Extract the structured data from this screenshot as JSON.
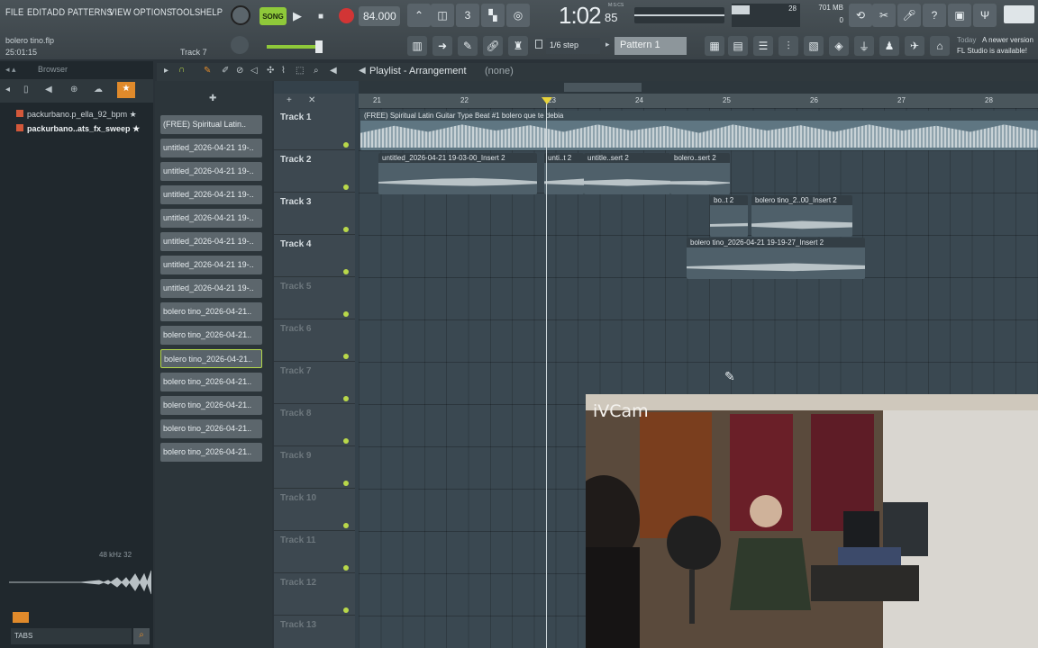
{
  "menu": [
    "FILE",
    "EDIT",
    "ADD",
    "PATTERNS",
    "VIEW",
    "OPTIONS",
    "TOOLS",
    "HELP"
  ],
  "transport": {
    "mode": "SONG",
    "tempo": "84.000",
    "time": "1:02",
    "time_small": "85",
    "time_label": "M:S:CS"
  },
  "monitor": {
    "mem": "701 MB",
    "cpu": "28",
    "poly": "0"
  },
  "project": {
    "file": "bolero tino.flp",
    "position": "25:01:15",
    "target": "Track 7"
  },
  "snap": "1/6 step",
  "pattern_selector": "Pattern 1",
  "news": {
    "label": "Today",
    "line1": "A newer version",
    "line2": "FL Studio is available!"
  },
  "browser": {
    "title": "Browser",
    "items": [
      "packurbano.p_ella_92_bpm",
      "packurbano..ats_fx_sweep"
    ],
    "waveform_info": "48 kHz 32",
    "tabs": "TABS"
  },
  "patterns": [
    "(FREE) Spiritual Latin..",
    "untitled_2026-04-21 19-..",
    "untitled_2026-04-21 19-..",
    "untitled_2026-04-21 19-..",
    "untitled_2026-04-21 19-..",
    "untitled_2026-04-21 19-..",
    "untitled_2026-04-21 19-..",
    "untitled_2026-04-21 19-..",
    "bolero tino_2026-04-21..",
    "bolero tino_2026-04-21..",
    "bolero tino_2026-04-21..",
    "bolero tino_2026-04-21..",
    "bolero tino_2026-04-21..",
    "bolero tino_2026-04-21..",
    "bolero tino_2026-04-21.."
  ],
  "selected_pattern_index": 10,
  "playlist": {
    "title": "Playlist - Arrangement",
    "sub": "(none)"
  },
  "ruler": [
    "21",
    "22",
    "23",
    "24",
    "25",
    "26",
    "27",
    "28"
  ],
  "tracks": [
    "Track 1",
    "Track 2",
    "Track 3",
    "Track 4",
    "Track 5",
    "Track 6",
    "Track 7",
    "Track 8",
    "Track 9",
    "Track 10",
    "Track 11",
    "Track 12",
    "Track 13"
  ],
  "clips": [
    {
      "name": "(FREE) Spiritual Latin Guitar Type Beat #1 bolero que te debia"
    },
    {
      "name": "untitled_2026-04-21 19-03-00_Insert 2"
    },
    {
      "name": "unti..t 2"
    },
    {
      "name": "untitle..sert 2"
    },
    {
      "name": "bolero..sert 2"
    },
    {
      "name": "bo..t 2"
    },
    {
      "name": "bolero tino_2..00_Insert 2"
    },
    {
      "name": "bolero tino_2026-04-21 19-19-27_Insert 2"
    }
  ],
  "webcam": {
    "label": "iVCam"
  },
  "colors": {
    "accent": "#b9d84a",
    "clip": "#596d78",
    "clip_hdr": "#4e5f68"
  }
}
